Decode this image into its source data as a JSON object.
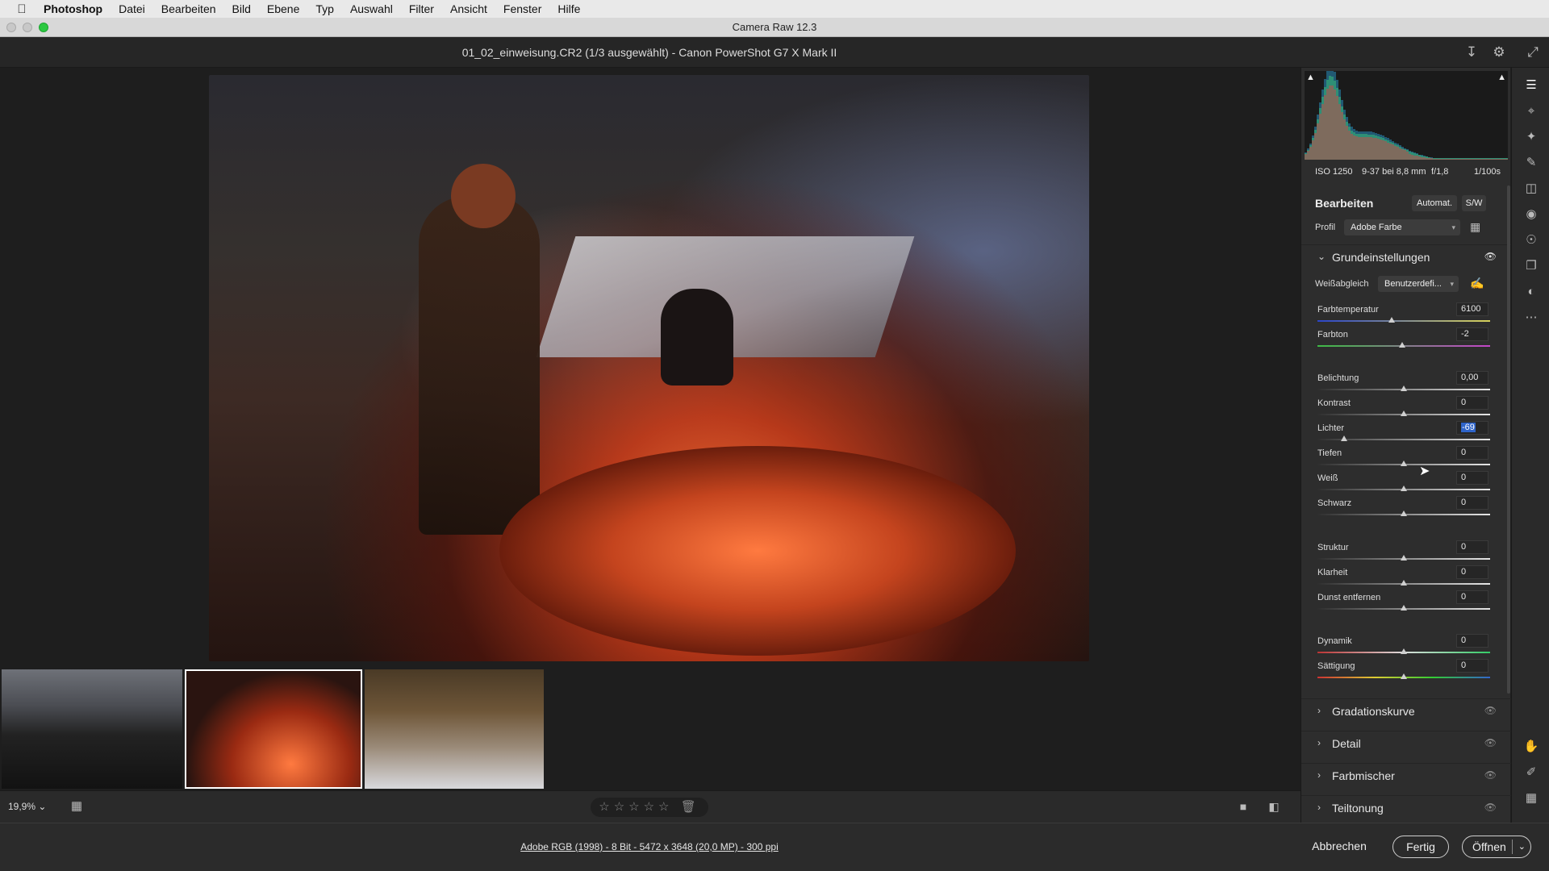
{
  "menubar": {
    "apple": "",
    "items": [
      "Photoshop",
      "Datei",
      "Bearbeiten",
      "Bild",
      "Ebene",
      "Typ",
      "Auswahl",
      "Filter",
      "Ansicht",
      "Fenster",
      "Hilfe"
    ]
  },
  "window": {
    "title": "Camera Raw 12.3"
  },
  "file": {
    "title": "01_02_einweisung.CR2 (1/3 ausgewählt) - Canon PowerShot G7 X Mark II"
  },
  "histogram": {
    "iso": "ISO 1250",
    "lens": "9-37 bei 8,8 mm",
    "aperture": "f/1,8",
    "shutter": "1/100s"
  },
  "edit": {
    "title": "Bearbeiten",
    "auto_label": "Automat.",
    "bw_label": "S/W",
    "profile_label": "Profil",
    "profile_value": "Adobe Farbe"
  },
  "basic": {
    "title": "Grundeinstellungen",
    "wb_label": "Weißabgleich",
    "wb_value": "Benutzerdefi..."
  },
  "sliders": [
    {
      "label": "Farbtemperatur",
      "value": "6100",
      "pos": 0.43
    },
    {
      "label": "Farbton",
      "value": "-2",
      "pos": 0.49
    },
    {
      "label": "Belichtung",
      "value": "0,00",
      "pos": 0.5
    },
    {
      "label": "Kontrast",
      "value": "0",
      "pos": 0.5
    },
    {
      "label": "Lichter",
      "value": "-69",
      "pos": 0.155
    },
    {
      "label": "Tiefen",
      "value": "0",
      "pos": 0.5
    },
    {
      "label": "Weiß",
      "value": "0",
      "pos": 0.5
    },
    {
      "label": "Schwarz",
      "value": "0",
      "pos": 0.5
    },
    {
      "label": "Struktur",
      "value": "0",
      "pos": 0.5
    },
    {
      "label": "Klarheit",
      "value": "0",
      "pos": 0.5
    },
    {
      "label": "Dunst entfernen",
      "value": "0",
      "pos": 0.5
    },
    {
      "label": "Dynamik",
      "value": "0",
      "pos": 0.5
    },
    {
      "label": "Sättigung",
      "value": "0",
      "pos": 0.5
    }
  ],
  "groups": [
    "Gradationskurve",
    "Detail",
    "Farbmischer",
    "Teiltonung"
  ],
  "toolbar": {
    "zoom": "19,9%",
    "stars": "☆☆☆☆☆"
  },
  "footer": {
    "meta": "Adobe RGB (1998) - 8 Bit - 5472 x 3648 (20,0 MP) - 300 ppi",
    "cancel": "Abbrechen",
    "done": "Fertig",
    "open": "Öffnen"
  }
}
